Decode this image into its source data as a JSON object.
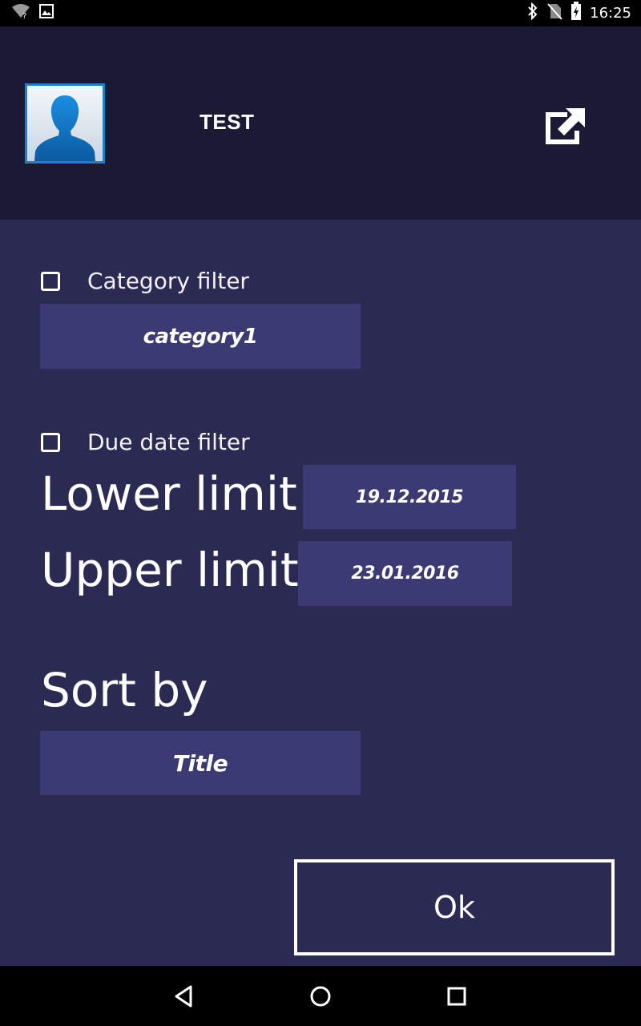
{
  "status_bar": {
    "time": "16:25",
    "left_icons": [
      "wifi-unknown-icon",
      "image-notification-icon"
    ],
    "right_icons": [
      "bluetooth-icon",
      "no-sim-icon",
      "battery-charging-icon"
    ]
  },
  "header": {
    "title": "TEST",
    "avatar_icon": "user-avatar-icon",
    "share_icon": "share-external-icon"
  },
  "filters": {
    "category": {
      "label": "Category filter",
      "checked": false,
      "value": "category1"
    },
    "due_date": {
      "label": "Due date filter",
      "checked": false,
      "lower_label": "Lower limit",
      "lower_value": "19.12.2015",
      "upper_label": "Upper limit",
      "upper_value": "23.01.2016"
    }
  },
  "sort": {
    "label": "Sort by",
    "value": "Title"
  },
  "actions": {
    "ok_label": "Ok"
  },
  "nav_bar": {
    "icons": [
      "back-icon",
      "home-icon",
      "recents-icon"
    ]
  },
  "colors": {
    "background": "#2b2a52",
    "header": "#1b1a35",
    "picker": "#3c3a72",
    "avatar_border": "#1e7fd0"
  }
}
